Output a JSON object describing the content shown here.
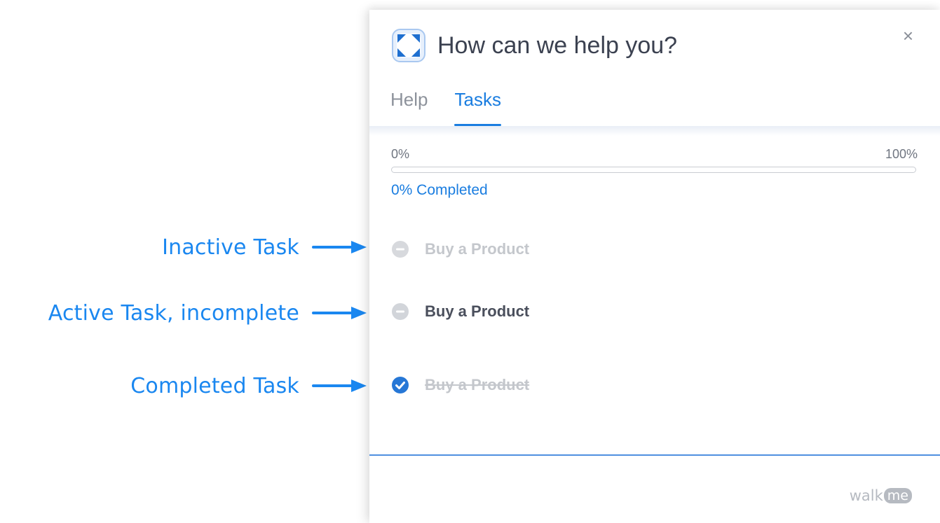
{
  "annotations": [
    {
      "label": "Inactive Task"
    },
    {
      "label": "Active Task, incomplete"
    },
    {
      "label": "Completed Task"
    }
  ],
  "widget": {
    "title": "How can we help you?",
    "close_label": "×",
    "tabs": [
      {
        "label": "Help",
        "active": false
      },
      {
        "label": "Tasks",
        "active": true
      }
    ],
    "progress": {
      "min_label": "0%",
      "max_label": "100%",
      "value": 0,
      "completed_label": "0% Completed"
    },
    "tasks": [
      {
        "label": "Buy a Product",
        "state": "inactive",
        "icon": "minus-circle-icon"
      },
      {
        "label": "Buy a Product",
        "state": "active",
        "icon": "minus-circle-icon"
      },
      {
        "label": "Buy a Product",
        "state": "completed",
        "icon": "check-circle-icon"
      }
    ],
    "brand": {
      "prefix": "walk",
      "suffix": "me"
    }
  },
  "colors": {
    "accent": "#1a7de0",
    "annotation": "#1a87f0",
    "muted": "#c4c7cc",
    "active_text": "#4a4f5c"
  }
}
